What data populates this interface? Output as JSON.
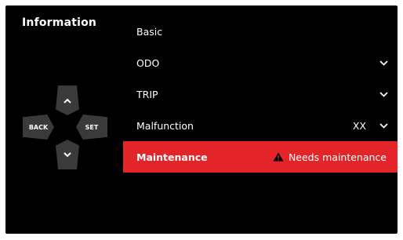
{
  "panel": {
    "title": "Information"
  },
  "menu": {
    "items": [
      {
        "label": "Basic"
      },
      {
        "label": "ODO"
      },
      {
        "label": "TRIP"
      },
      {
        "label": "Malfunction",
        "value": "XX"
      }
    ],
    "selected": {
      "label": "Maintenance",
      "status": "Needs maintenance"
    }
  },
  "controls": {
    "back_label": "BACK",
    "set_label": "SET"
  },
  "colors": {
    "background": "#000000",
    "highlight": "#e32429",
    "button": "#3a3a3a",
    "text": "#ffffff"
  },
  "icons": [
    "chevron-down-icon",
    "chevron-up-icon",
    "warning-icon"
  ]
}
